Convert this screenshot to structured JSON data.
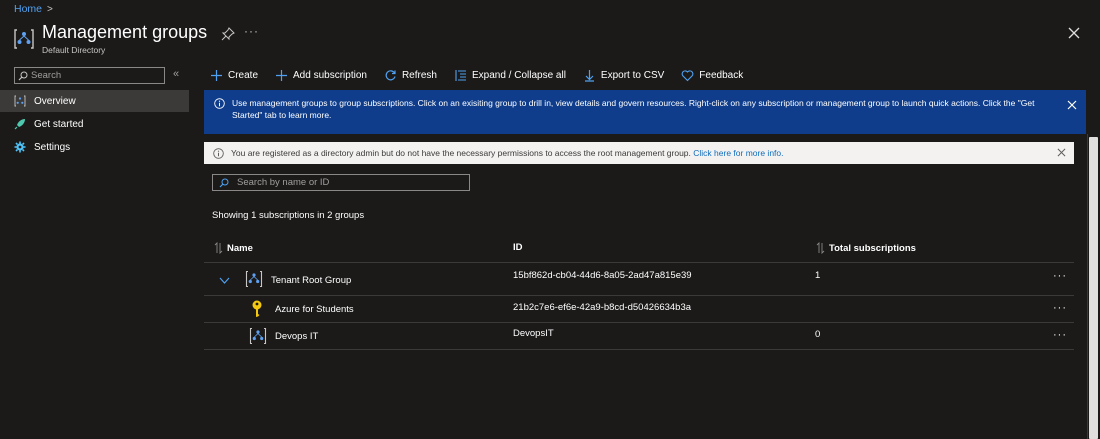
{
  "breadcrumb": {
    "home": "Home",
    "separator": ">"
  },
  "header": {
    "title": "Management groups",
    "subtitle": "Default Directory",
    "more": "···"
  },
  "nav": {
    "search_placeholder": "Search",
    "collapse": "«",
    "items": [
      {
        "label": "Overview",
        "icon": "management-group-icon",
        "selected": true
      },
      {
        "label": "Get started",
        "icon": "rocket-icon",
        "selected": false
      },
      {
        "label": "Settings",
        "icon": "gear-icon",
        "selected": false
      }
    ]
  },
  "toolbar": {
    "create": "Create",
    "add_subscription": "Add subscription",
    "refresh": "Refresh",
    "expand_collapse": "Expand / Collapse all",
    "export_csv": "Export to CSV",
    "feedback": "Feedback"
  },
  "info_banner": {
    "text": "Use management groups to group subscriptions. Click on an exisiting group to drill in, view details and govern resources. Right-click on any subscription or management group to launch quick actions. Click the \"Get Started\" tab to learn more."
  },
  "warning_banner": {
    "text": "You are registered as a directory admin but do not have the necessary permissions to access the root management group.",
    "link": "Click here for more info."
  },
  "grid": {
    "search_placeholder": "Search by name or ID",
    "count_text": "Showing 1 subscriptions in 2 groups",
    "columns": {
      "name": "Name",
      "id": "ID",
      "total": "Total subscriptions"
    },
    "rows": [
      {
        "name": "Tenant Root Group",
        "id": "15bf862d-cb04-44d6-8a05-2ad47a815e39",
        "total": "1",
        "more": "···"
      },
      {
        "name": "Azure for Students",
        "id": "21b2c7e6-ef6e-42a9-b8cd-d50426634b3a",
        "total": "",
        "more": "···"
      },
      {
        "name": "Devops IT",
        "id": "DevopsIT",
        "total": "0",
        "more": "···"
      }
    ]
  },
  "colors": {
    "background": "#1b1a19",
    "link": "#4fa0f0",
    "info_banner": "#0f3d8c",
    "warning_banner": "#f3f2f1",
    "nav_selected": "#3b3a39"
  }
}
